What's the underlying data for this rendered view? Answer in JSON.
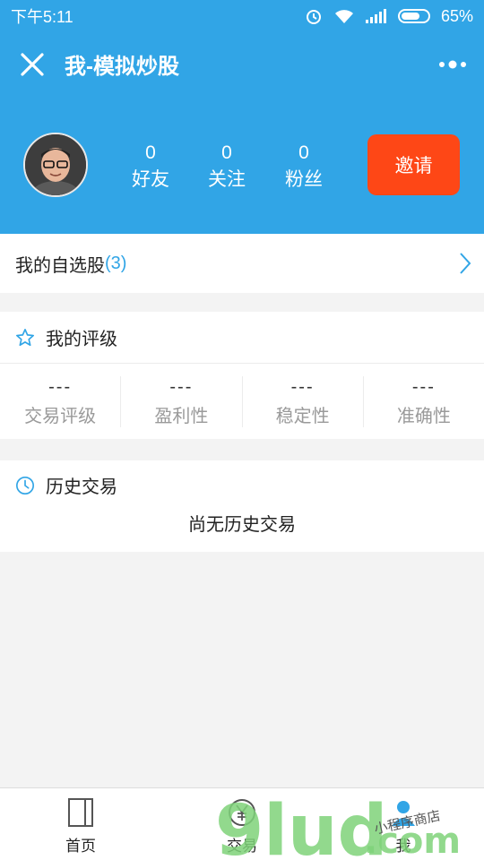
{
  "status_bar": {
    "time": "下午5:11",
    "battery": "65%"
  },
  "header": {
    "title": "我-模拟炒股",
    "invite_label": "邀请"
  },
  "stats": [
    {
      "value": "0",
      "label": "好友"
    },
    {
      "value": "0",
      "label": "关注"
    },
    {
      "value": "0",
      "label": "粉丝"
    }
  ],
  "watchlist": {
    "label": "我的自选股",
    "count": "(3)"
  },
  "rating": {
    "title": "我的评级",
    "items": [
      {
        "value": "---",
        "label": "交易评级"
      },
      {
        "value": "---",
        "label": "盈利性"
      },
      {
        "value": "---",
        "label": "稳定性"
      },
      {
        "value": "---",
        "label": "准确性"
      }
    ]
  },
  "history": {
    "title": "历史交易",
    "empty_text": "尚无历史交易"
  },
  "tabs": [
    {
      "label": "首页",
      "icon": "book-icon"
    },
    {
      "label": "交易",
      "icon": "yen-circle-icon"
    },
    {
      "label": "我",
      "icon": "person-icon"
    }
  ],
  "watermark": {
    "logo": "9lud",
    "suffix": ".com",
    "tagline": "小程序商店"
  },
  "colors": {
    "primary": "#31a5e6",
    "invite": "#fe4716",
    "background": "#f3f3f3"
  }
}
